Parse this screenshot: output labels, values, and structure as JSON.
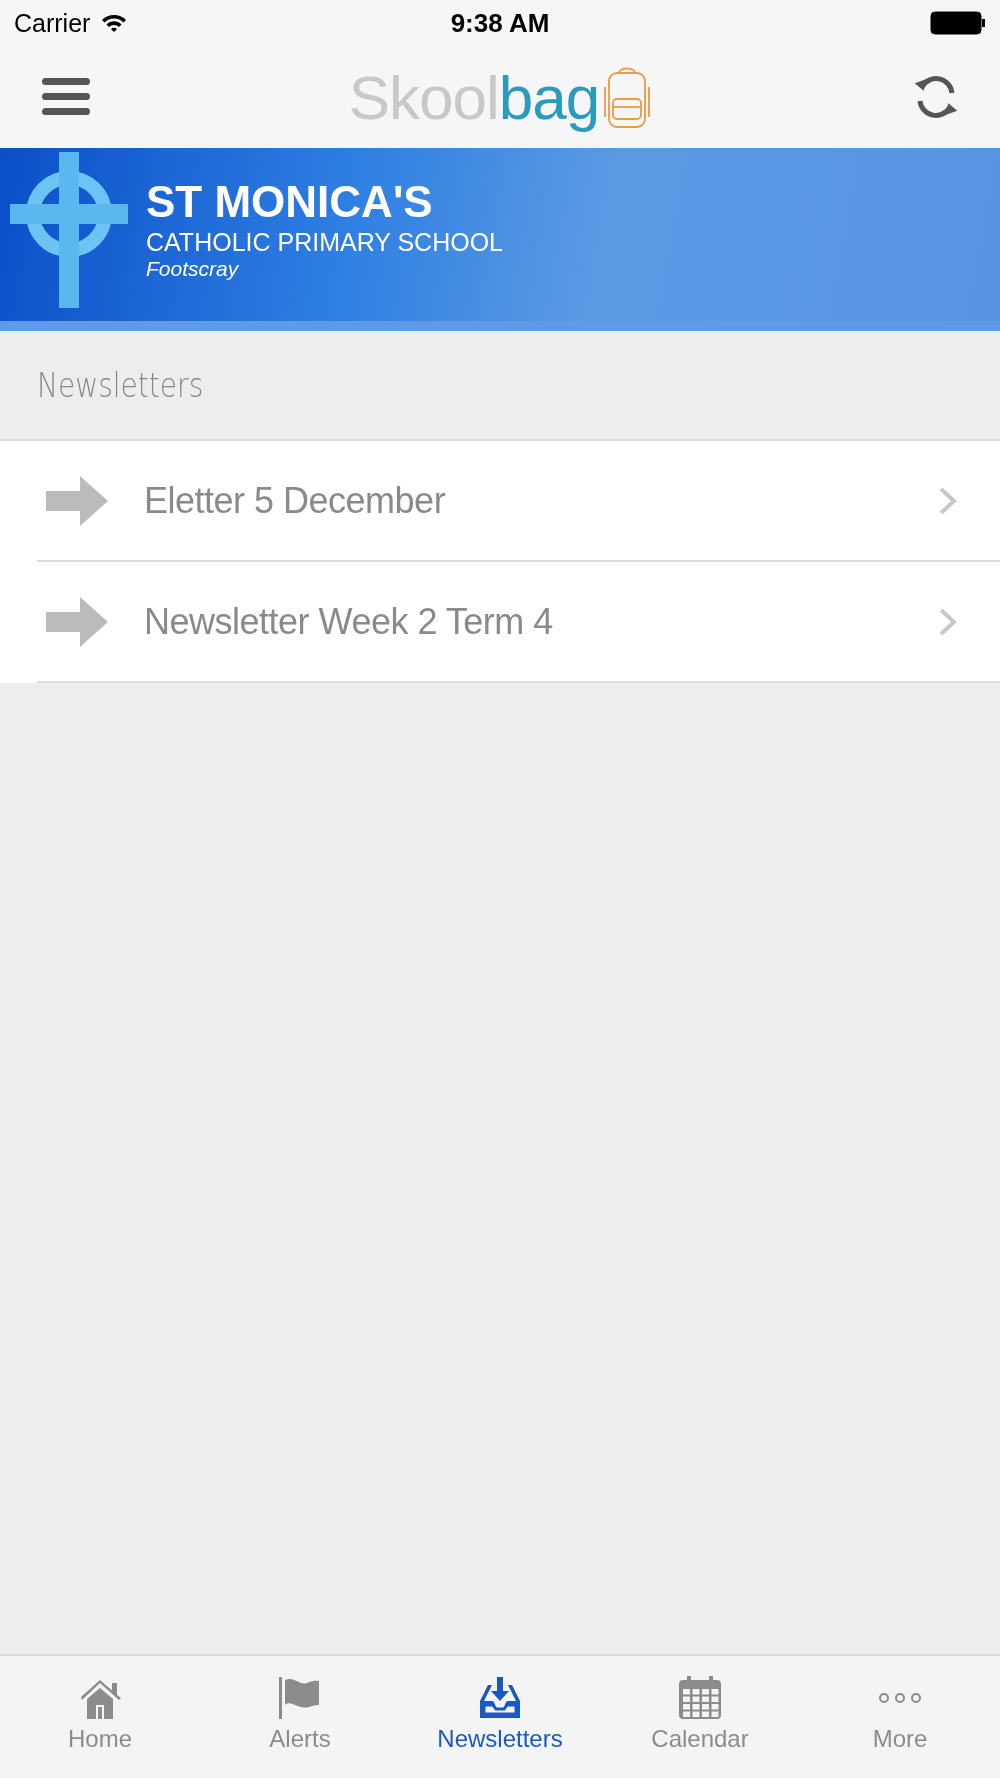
{
  "status_bar": {
    "carrier": "Carrier",
    "time": "9:38 AM"
  },
  "nav_bar": {
    "logo": {
      "first": "Skool",
      "second": "bag"
    }
  },
  "banner": {
    "school_name": "ST MONICA'S",
    "school_type": "CATHOLIC PRIMARY SCHOOL",
    "suburb": "Footscray"
  },
  "section": {
    "title": "Newsletters"
  },
  "items": [
    {
      "title": "Eletter 5 December"
    },
    {
      "title": "Newsletter Week 2 Term 4"
    }
  ],
  "tab_bar": [
    {
      "label": "Home",
      "selected": false
    },
    {
      "label": "Alerts",
      "selected": false
    },
    {
      "label": "Newsletters",
      "selected": true
    },
    {
      "label": "Calendar",
      "selected": false
    },
    {
      "label": "More",
      "selected": false
    }
  ]
}
